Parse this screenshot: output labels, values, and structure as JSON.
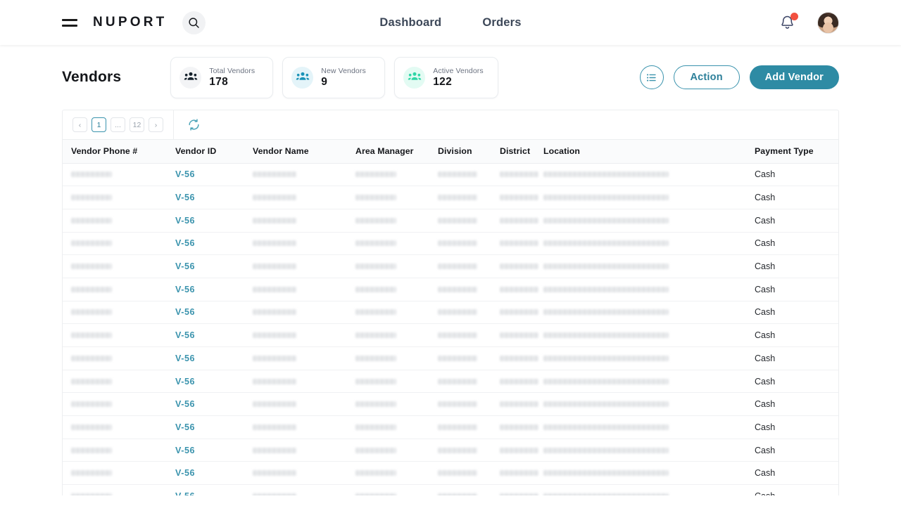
{
  "header": {
    "menu_icon": "hamburger-icon",
    "brand": "NUPORT",
    "search_icon": "search-icon",
    "nav": [
      {
        "label": "Dashboard"
      },
      {
        "label": "Orders"
      }
    ],
    "notifications_icon": "bell-icon",
    "has_notification_badge": true,
    "avatar": "user-avatar"
  },
  "page": {
    "title": "Vendors",
    "stats": [
      {
        "label": "Total Vendors",
        "value": "178",
        "icon": "people-group-icon",
        "icon_color": "#14202b",
        "icon_bg": "#f3f4f6"
      },
      {
        "label": "New Vendors",
        "value": "9",
        "icon": "people-group-icon",
        "icon_color": "#1a93b8",
        "icon_bg": "#e4f4f9"
      },
      {
        "label": "Active Vendors",
        "value": "122",
        "icon": "people-group-icon",
        "icon_color": "#2fd6a6",
        "icon_bg": "#e3fbf3"
      }
    ],
    "actions": {
      "list_view_icon": "list-icon",
      "action_label": "Action",
      "add_label": "Add Vendor"
    }
  },
  "toolbar": {
    "prev_label": "‹",
    "next_label": "›",
    "pages": [
      "1",
      "...",
      "12"
    ],
    "active_page": "1",
    "refresh_icon": "refresh-icon"
  },
  "table": {
    "columns": [
      "Vendor Phone #",
      "Vendor ID",
      "Vendor Name",
      "Area Manager",
      "Division",
      "District",
      "Location",
      "Payment Type"
    ],
    "row_count": 15,
    "vendor_id": "V-56",
    "payment_type": "Cash",
    "redacted_cells": [
      "Vendor Phone #",
      "Vendor Name",
      "Area Manager",
      "Division",
      "District",
      "Location"
    ]
  },
  "colors": {
    "accent_teal": "#2e8ba4",
    "link_teal": "#3a93ad",
    "badge_red": "#f2503f",
    "mint": "#2fd6a6",
    "text_dark": "#14161a"
  }
}
